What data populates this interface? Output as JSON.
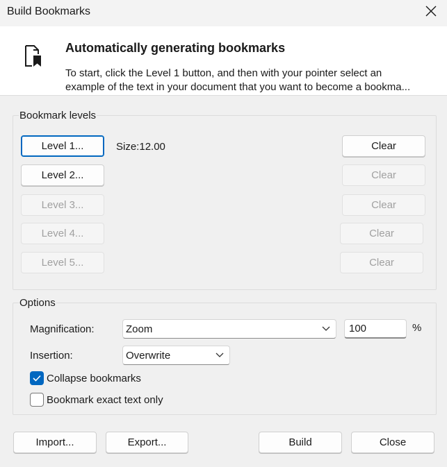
{
  "window": {
    "title": "Build Bookmarks"
  },
  "header": {
    "icon": "bookmark-document-icon",
    "title": "Automatically generating bookmarks",
    "desc_line1": "To start, click the Level 1 button, and then with your pointer select an",
    "desc_line2": "example of the text in your document that you want to become a bookma..."
  },
  "levels": {
    "group_label": "Bookmark levels",
    "size_text": "Size:12.00",
    "rows": [
      {
        "level_label": "Level 1...",
        "clear_label": "Clear",
        "level_enabled": true,
        "clear_enabled": true
      },
      {
        "level_label": "Level 2...",
        "clear_label": "Clear",
        "level_enabled": true,
        "clear_enabled": false
      },
      {
        "level_label": "Level 3...",
        "clear_label": "Clear",
        "level_enabled": false,
        "clear_enabled": false
      },
      {
        "level_label": "Level 4...",
        "clear_label": "Clear",
        "level_enabled": false,
        "clear_enabled": false
      },
      {
        "level_label": "Level 5...",
        "clear_label": "Clear",
        "level_enabled": false,
        "clear_enabled": false
      }
    ]
  },
  "options": {
    "group_label": "Options",
    "magnification_label": "Magnification:",
    "magnification_value": "Zoom",
    "zoom_value": "100",
    "percent": "%",
    "insertion_label": "Insertion:",
    "insertion_value": "Overwrite",
    "collapse_label": "Collapse bookmarks",
    "collapse_checked": true,
    "exact_label": "Bookmark exact text only",
    "exact_checked": false
  },
  "footer": {
    "import_label": "Import...",
    "export_label": "Export...",
    "build_label": "Build",
    "close_label": "Close"
  },
  "colors": {
    "accent": "#0067c0",
    "disabled_text": "#a0a0a0"
  }
}
